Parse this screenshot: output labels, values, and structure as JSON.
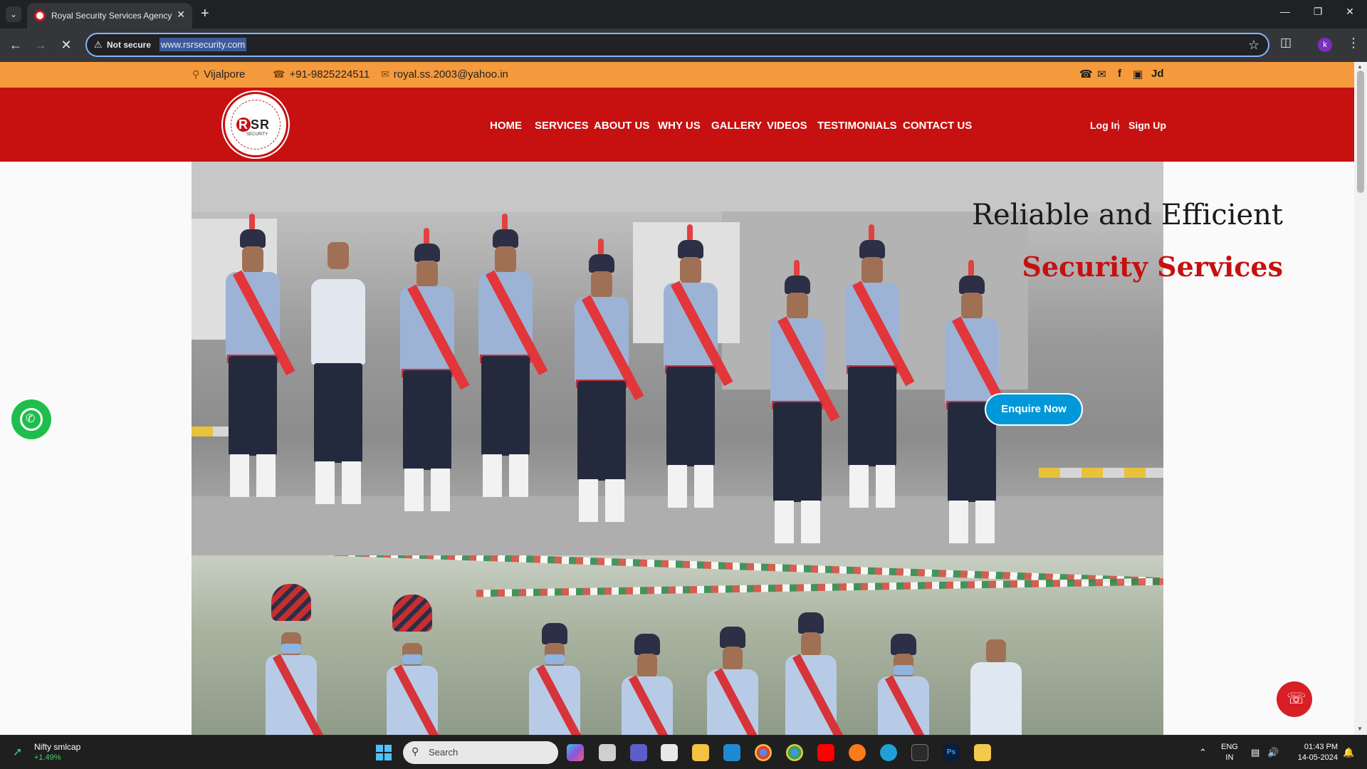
{
  "browser": {
    "tab_title": "Royal Security Services Agency",
    "security_label": "Not secure",
    "url": "www.rsrsecurity.com",
    "profile_initial": "k"
  },
  "site": {
    "topbar": {
      "location": "Vijalpore",
      "phone": "+91-9825224511",
      "email": "royal.ss.2003@yahoo.in",
      "social_jd": "Jd"
    },
    "logo": {
      "text": "SR",
      "initial": "R",
      "sub": "SECURITY"
    },
    "nav": [
      "HOME",
      "SERVICES",
      "ABOUT US",
      "WHY US",
      "GALLERY",
      "VIDEOS",
      "TESTIMONIALS",
      "CONTACT US"
    ],
    "auth": {
      "login": "Log In",
      "signup": "Sign Up"
    },
    "hero": {
      "line1": "Reliable and Efficient",
      "line2": "Security Services",
      "cta": "Enquire Now"
    },
    "colors": {
      "topbar": "#f59a3d",
      "header": "#c71010",
      "cta": "#0098d8",
      "whatsapp": "#1ebe4c"
    }
  },
  "taskbar": {
    "stock_name": "Nifty smlcap",
    "stock_change": "+1.49%",
    "search_placeholder": "Search",
    "lang_line1": "ENG",
    "lang_line2": "IN",
    "time": "01:43 PM",
    "date": "14-05-2024"
  }
}
